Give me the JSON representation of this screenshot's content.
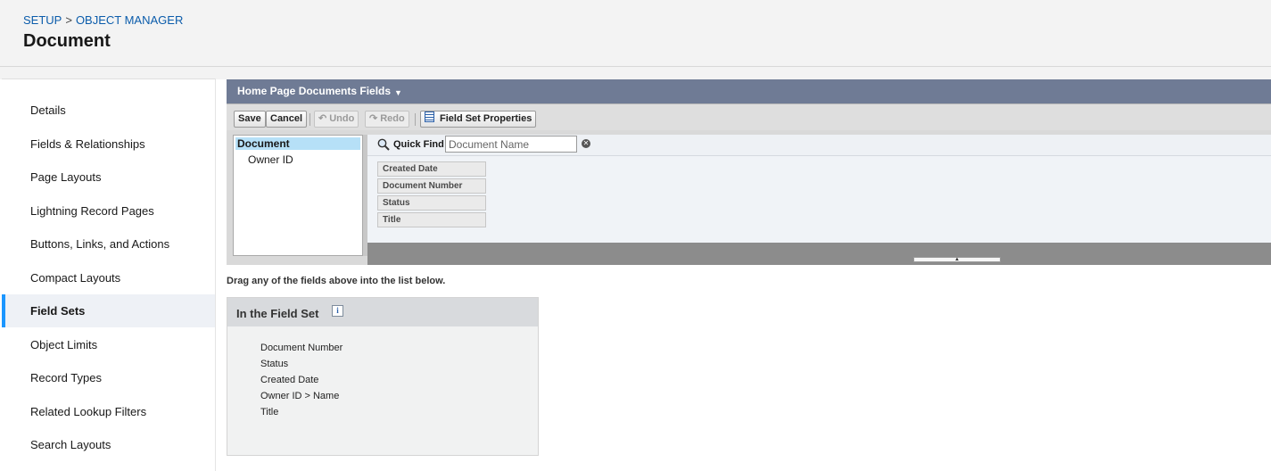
{
  "breadcrumb": {
    "setup": "SETUP",
    "separator": ">",
    "object_manager": "OBJECT MANAGER"
  },
  "page_title": "Document",
  "sidebar": {
    "items": [
      {
        "label": "Details",
        "active": false
      },
      {
        "label": "Fields & Relationships",
        "active": false
      },
      {
        "label": "Page Layouts",
        "active": false
      },
      {
        "label": "Lightning Record Pages",
        "active": false
      },
      {
        "label": "Buttons, Links, and Actions",
        "active": false
      },
      {
        "label": "Compact Layouts",
        "active": false
      },
      {
        "label": "Field Sets",
        "active": true
      },
      {
        "label": "Object Limits",
        "active": false
      },
      {
        "label": "Record Types",
        "active": false
      },
      {
        "label": "Related Lookup Filters",
        "active": false
      },
      {
        "label": "Search Layouts",
        "active": false
      }
    ]
  },
  "editor": {
    "title": "Home Page Documents Fields",
    "caret_icon": "chevron-down-icon",
    "toolbar": {
      "save": "Save",
      "cancel": "Cancel",
      "undo": "Undo",
      "redo": "Redo",
      "properties": "Field Set Properties"
    },
    "tree": [
      {
        "label": "Document",
        "selected": true
      },
      {
        "label": "Owner ID",
        "selected": false
      }
    ],
    "quick_find": {
      "label": "Quick Find",
      "placeholder": "Document Name"
    },
    "fields": [
      "Created Date",
      "Document Number",
      "Status",
      "Title"
    ]
  },
  "drag_hint": "Drag any of the fields above into the list below.",
  "field_set": {
    "title": "In the Field Set",
    "info_icon": "i",
    "items": [
      "Document Number",
      "Status",
      "Created Date",
      "Owner ID > Name",
      "Title"
    ]
  },
  "colors": {
    "header_bar": "#6f7b95",
    "active_accent": "#1b96ff",
    "link": "#0b5cab",
    "tree_selected": "#b6e0f7"
  }
}
